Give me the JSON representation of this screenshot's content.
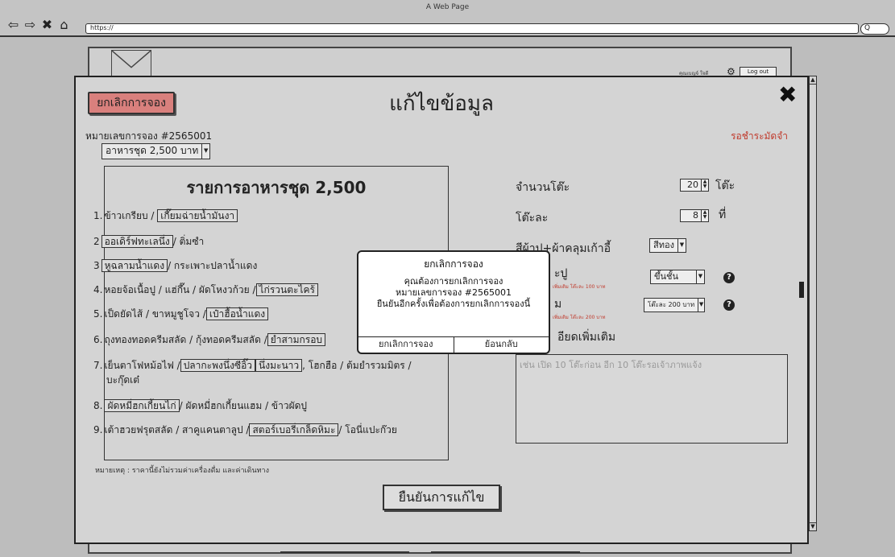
{
  "browser": {
    "title": "A Web Page",
    "url": "https://",
    "nav_icons": [
      "back-arrow",
      "forward-arrow",
      "stop-x",
      "home"
    ],
    "search_label": "Q"
  },
  "background": {
    "user_text": "คุณเบญจ์ ใจดี",
    "logout": "Log out"
  },
  "modal": {
    "cancel_booking": "ยกเลิกการจอง",
    "title": "แก้ไขข้อมูล",
    "close": "✖",
    "booking_no": "หมายเลขการจอง #2565001",
    "status": "รอชำระมัดจำ",
    "set_select": "อาหารชุด 2,500 บาท",
    "menu": {
      "title": "รายการอาหารชุด 2,500",
      "items": [
        {
          "num": "1.",
          "parts": [
            "ข้าวเกรียบ / ",
            "[เกี๊ยมฉ่ายน้ำมันงา]"
          ]
        },
        {
          "num": "2",
          "parts": [
            "[ออเดิร์ฟทะเลนึ่ง]",
            "/ ติ่มซำ"
          ]
        },
        {
          "num": "3",
          "parts": [
            "[หูฉลามน้ำแดง]",
            "/ กระเพาะปลาน้ำแดง"
          ]
        },
        {
          "num": "4.",
          "parts": [
            "หอยจ้อเนื้อปู / แฮ่กึ๊น / ผัดโหงวก้วย /",
            "[ไก่รวนตะไคร้]"
          ]
        },
        {
          "num": "5.",
          "parts": [
            "เป็ดยัดไส้ / ขาหมูชูโจว /",
            "[เป๋าฮื้อน้ำแดง]"
          ]
        },
        {
          "num": "6.",
          "parts": [
            "ถุงทองทอดครีมสลัด / กุ้งทอดครีมสลัด /",
            "[ยำสามกรอบ]"
          ]
        },
        {
          "num": "7.",
          "parts": [
            "เย็นตาโฟหม้อไฟ /",
            "[ปลากะพงนึ่งซีอิ๊ว]",
            "[นึ่งมะนาว]",
            ", โฮกฮือ / ต้มยำรวมมิตร /"
          ]
        },
        {
          "num": "",
          "parts": [
            "บะกุ๊ดเต๋"
          ]
        },
        {
          "num": "8.",
          "parts": [
            "[ผัดหมี่ฮกเกี้ยนไก่]",
            "/ ผัดหมี่ฮกเกี้ยนแฮม / ข้าวผัดปู"
          ]
        },
        {
          "num": "9.",
          "parts": [
            "เต้าฮวยฟรุตสลัด / สาคูแคนตาลูป /",
            "[สตอร์เบอรี่เกล็ดหิมะ]",
            "/ โอนี่แปะก๊วย"
          ]
        }
      ]
    },
    "note": "หมายเหตุ : ราคานี้ยังไม่รวมค่าเครื่องดื่ม และค่าเดินทาง",
    "confirm": "ยืนยันการแก้ไข",
    "form": {
      "tables_label": "จำนวนโต๊ะ",
      "tables_value": "20",
      "tables_unit": "โต๊ะ",
      "per_table_label": "โต๊ะละ",
      "per_table_value": "8",
      "per_table_unit": "ที่",
      "color_label": "สีผ้าปู+ผ้าคลุมเก้าอี้",
      "color_value": "สีทอง",
      "cloth_label_tail": "ะปู",
      "cloth_sub": "เพิ่มเติม โต๊ะละ 100 บาท",
      "cloth_value": "ขึ้นชั้น",
      "extra_label_tail": "ม",
      "extra_sub": "เพิ่มเติม โต๊ะละ 200 บาท",
      "extra_value": "โต๊ะละ 200 บาท",
      "details_label_tail": "อียดเพิ่มเติม",
      "details_placeholder": "เช่น เปิด 10 โต๊ะก่อน อีก 10 โต๊ะรอเจ้าภาพแจ้ง"
    }
  },
  "dialog": {
    "title": "ยกเลิกการจอง",
    "line1": "คุณต้องการยกเลิกการจอง",
    "line2": "หมายเลขการจอง #2565001",
    "line3": "ยืนยันอีกครั้งเพื่อต้องการยกเลิกการจองนี้",
    "confirm": "ยกเลิกการจอง",
    "back": "ย้อนกลับ"
  }
}
